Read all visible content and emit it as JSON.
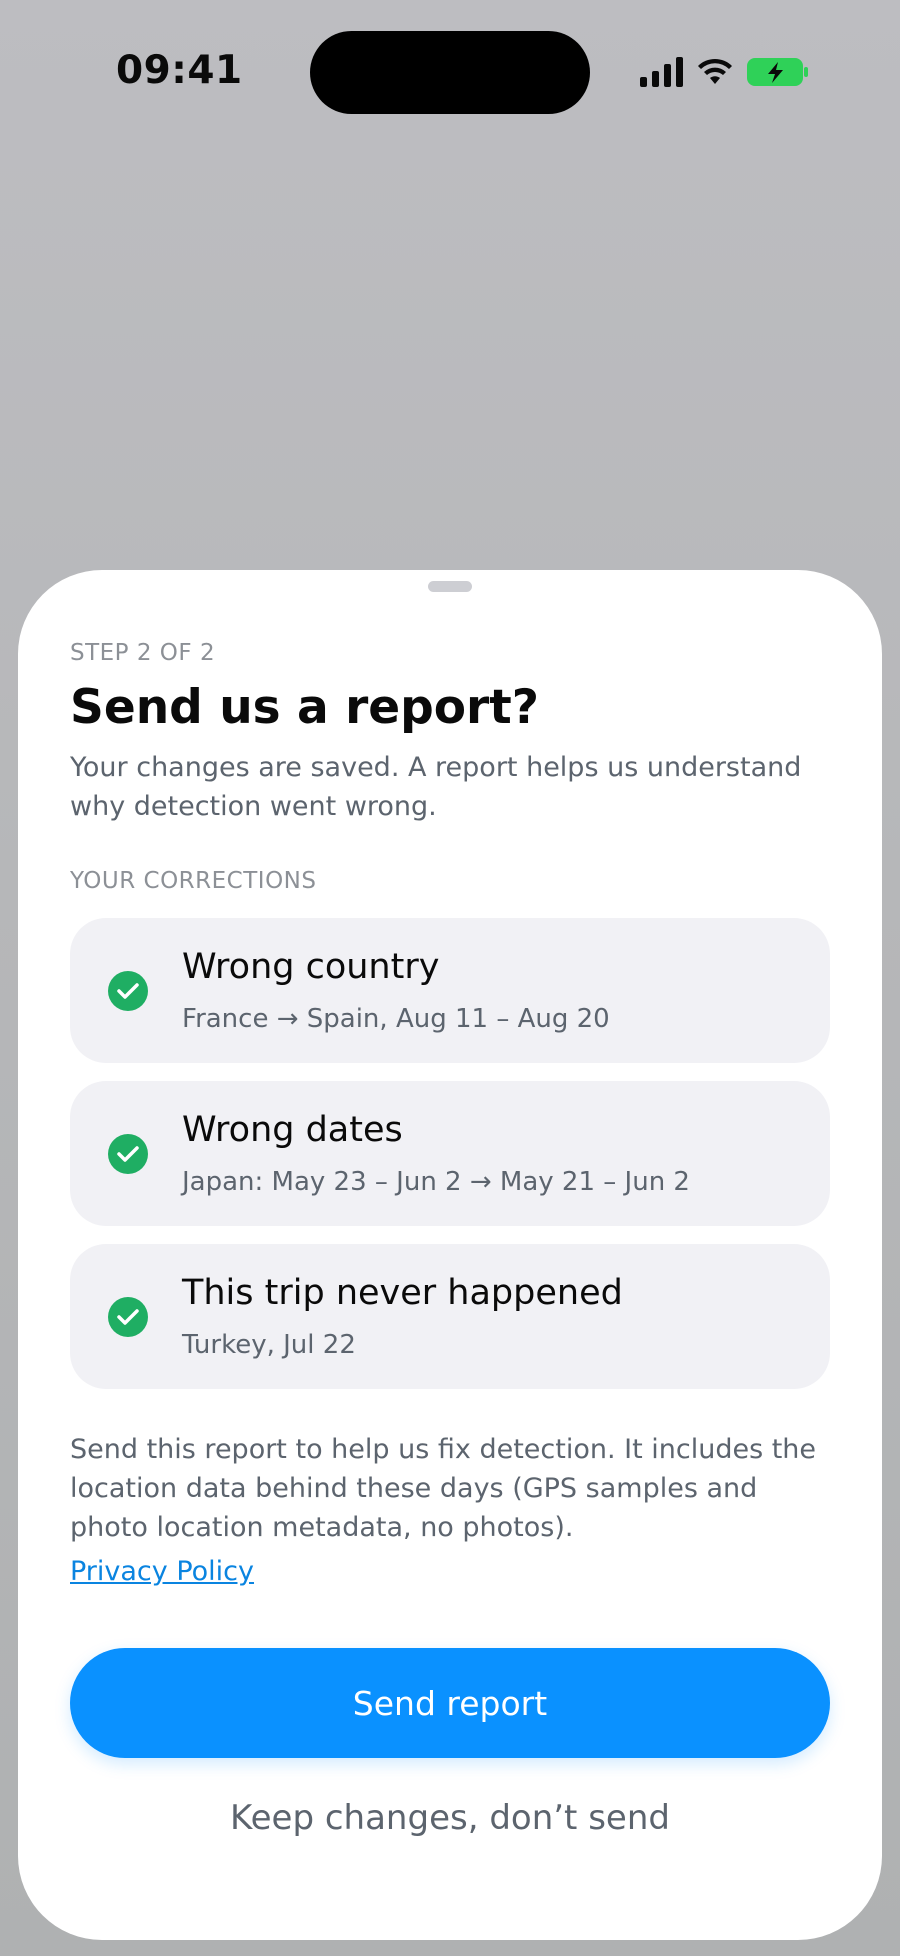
{
  "status_bar": {
    "time": "09:41",
    "icons": [
      "cellular-signal-icon",
      "wifi-icon",
      "battery-charging-icon"
    ]
  },
  "sheet": {
    "step": "STEP 2 OF 2",
    "title": "Send us a report?",
    "subtitle": "Your changes are saved. A report helps us understand why detection went wrong.",
    "section_label": "YOUR CORRECTIONS",
    "corrections": [
      {
        "title": "Wrong country",
        "detail": "France → Spain, Aug 11 – Aug 20",
        "icon": "check-circle-icon"
      },
      {
        "title": "Wrong dates",
        "detail": "Japan: May 23 – Jun 2 → May 21 – Jun 2",
        "icon": "check-circle-icon"
      },
      {
        "title": "This trip never happened",
        "detail": "Turkey, Jul 22",
        "icon": "check-circle-icon"
      }
    ],
    "note": "Send this report to help us fix detection. It includes the location data behind these days (GPS samples and photo location metadata, no photos).",
    "privacy_link": "Privacy Policy",
    "primary_button": "Send report",
    "secondary_button": "Keep changes, don’t send"
  },
  "colors": {
    "accent": "#0a91ff",
    "check": "#1fae63",
    "card_bg": "#f1f1f5",
    "battery": "#2fd158"
  }
}
